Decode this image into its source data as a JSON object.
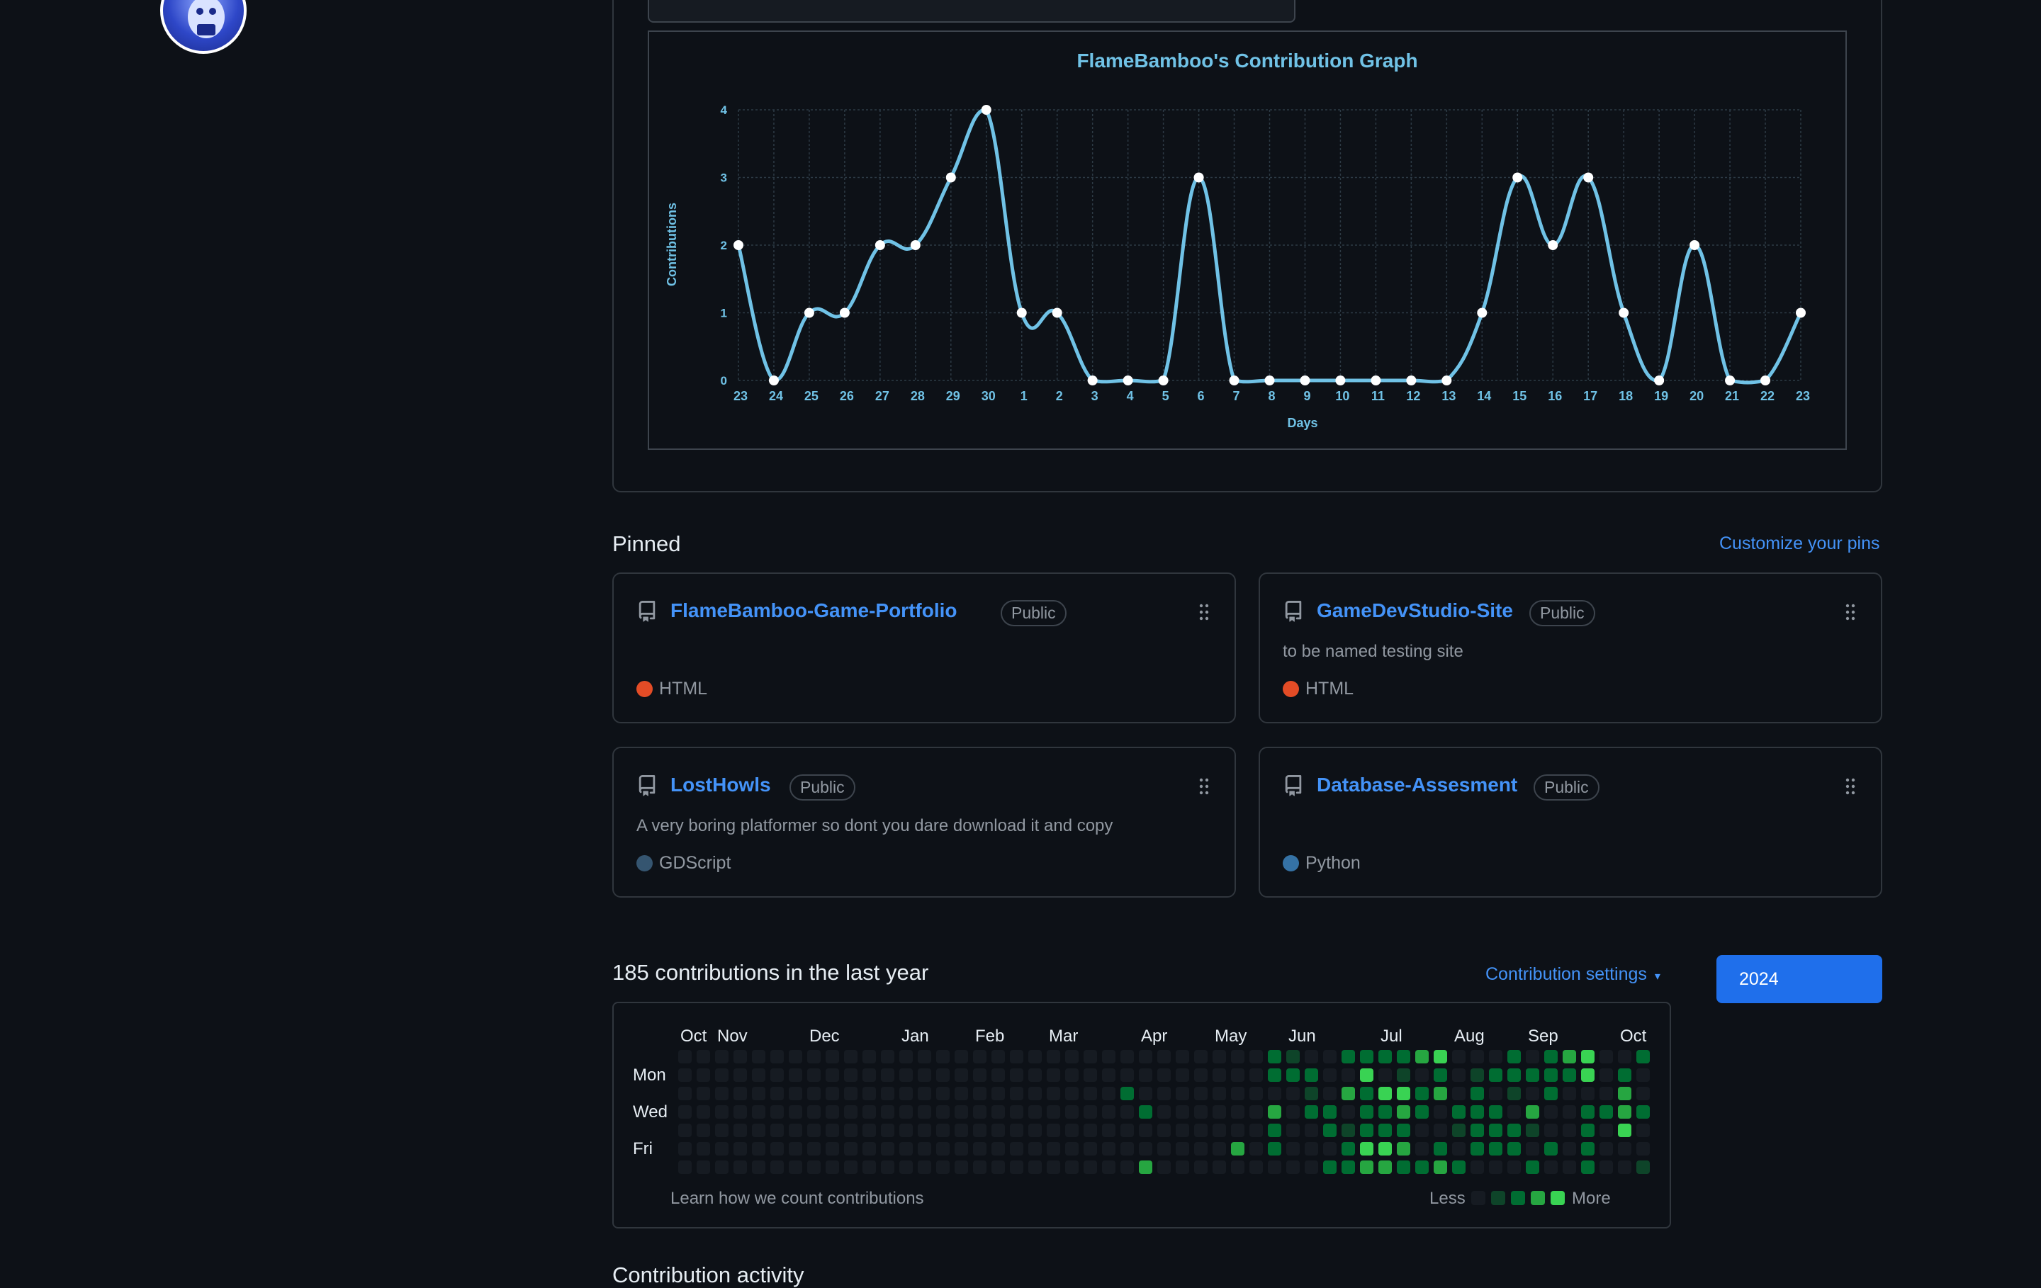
{
  "graph": {
    "title": "FlameBamboo's Contribution Graph",
    "ylabel": "Contributions",
    "xlabel": "Days"
  },
  "chart_data": {
    "type": "line",
    "title": "FlameBamboo's Contribution Graph",
    "xlabel": "Days",
    "ylabel": "Contributions",
    "x": [
      "23",
      "24",
      "25",
      "26",
      "27",
      "28",
      "29",
      "30",
      "1",
      "2",
      "3",
      "4",
      "5",
      "6",
      "7",
      "8",
      "9",
      "10",
      "11",
      "12",
      "13",
      "14",
      "15",
      "16",
      "17",
      "18",
      "19",
      "20",
      "21",
      "22",
      "23"
    ],
    "values": [
      2,
      0,
      1,
      1,
      2,
      2,
      3,
      4,
      1,
      1,
      0,
      0,
      0,
      3,
      0,
      0,
      0,
      0,
      0,
      0,
      0,
      1,
      3,
      2,
      3,
      1,
      0,
      2,
      0,
      0,
      1
    ],
    "ylim": [
      0,
      4
    ],
    "yticks": [
      0,
      1,
      2,
      3,
      4
    ],
    "grid": true,
    "colors": {
      "line": "#70c2e6",
      "point": "#ffffff",
      "text": "#70c2e6",
      "grid": "#2d3a45"
    }
  },
  "pinned": {
    "title": "Pinned",
    "customize_label": "Customize your pins",
    "items": [
      {
        "name": "FlameBamboo-Game-Portfolio",
        "visibility": "Public",
        "description": "",
        "language": "HTML",
        "lang_color": "#e34c26"
      },
      {
        "name": "GameDevStudio-Site",
        "visibility": "Public",
        "description": "to be named testing site",
        "language": "HTML",
        "lang_color": "#e34c26"
      },
      {
        "name": "LostHowls",
        "visibility": "Public",
        "description": "A very boring platformer so dont you dare download it and copy",
        "language": "GDScript",
        "lang_color": "#355570"
      },
      {
        "name": "Database-Assesment",
        "visibility": "Public",
        "description": "",
        "language": "Python",
        "lang_color": "#3572A5"
      }
    ]
  },
  "contributions": {
    "summary": "185 contributions in the last year",
    "settings_label": "Contribution settings",
    "year": "2024",
    "months": [
      "Oct",
      "Nov",
      "Dec",
      "Jan",
      "Feb",
      "Mar",
      "Apr",
      "May",
      "Jun",
      "Jul",
      "Aug",
      "Sep",
      "Oct"
    ],
    "day_labels": [
      "Mon",
      "Wed",
      "Fri"
    ],
    "learn_label": "Learn how we count contributions",
    "less_label": "Less",
    "more_label": "More",
    "level_colors": [
      "#161b22",
      "#0e4429",
      "#006d32",
      "#26a641",
      "#39d353"
    ]
  },
  "footer_peek": "Contribution activity"
}
